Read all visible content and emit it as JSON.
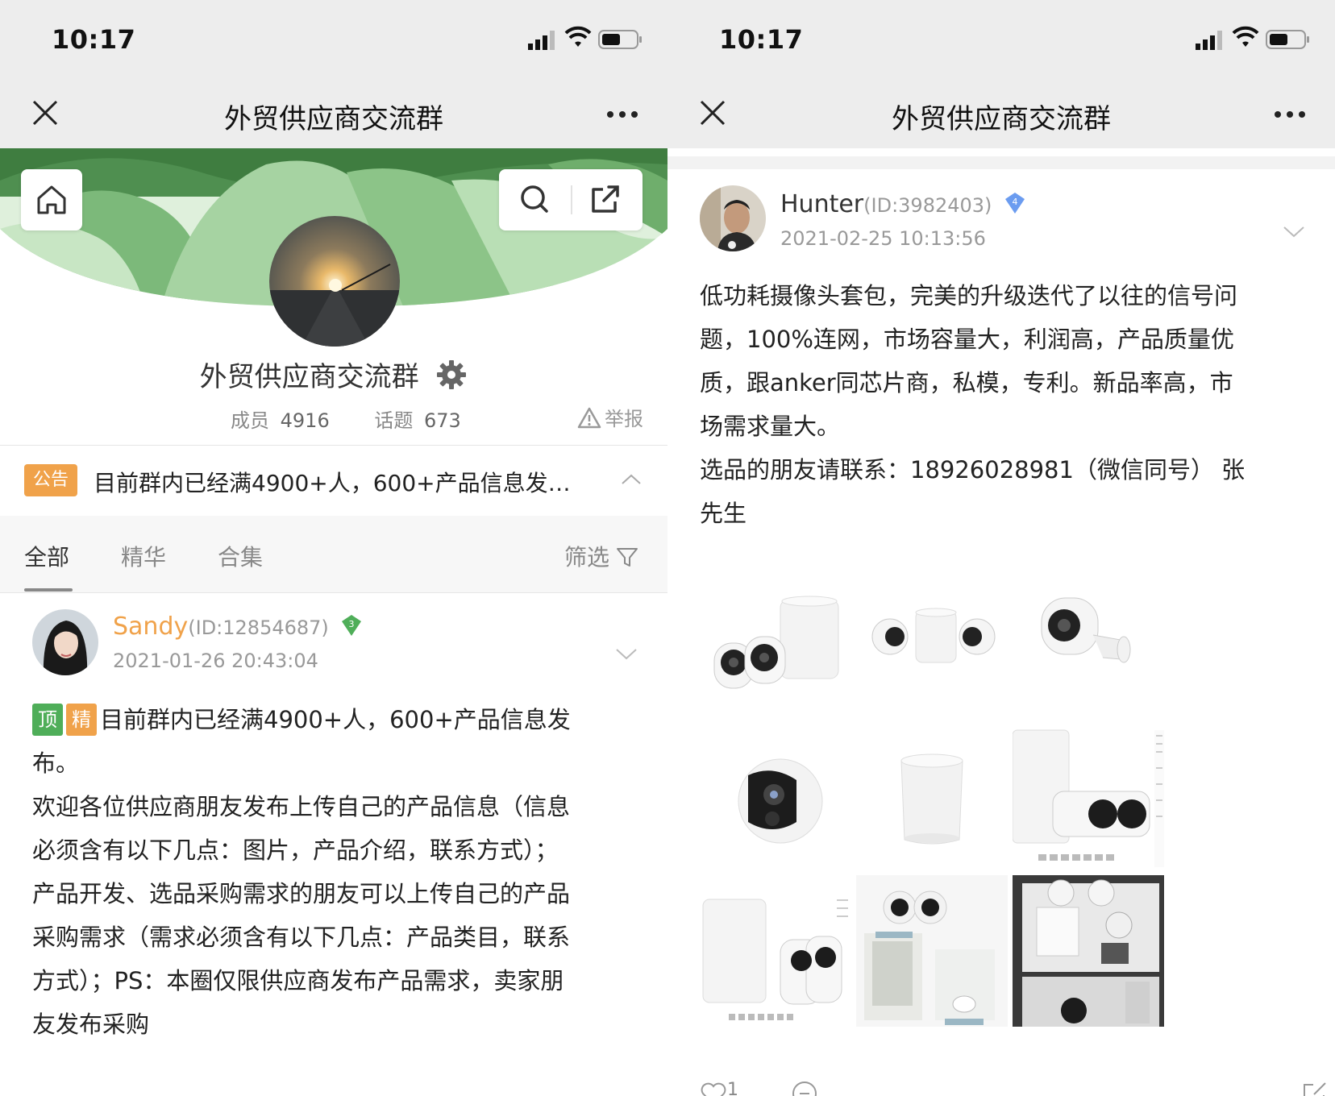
{
  "left": {
    "status": {
      "time": "10:17"
    },
    "nav": {
      "title": "外贸供应商交流群"
    },
    "group": {
      "name": "外贸供应商交流群",
      "members_label": "成员",
      "members_value": "4916",
      "topics_label": "话题",
      "topics_value": "673",
      "report_label": "举报"
    },
    "notice": {
      "tag": "公告",
      "text": "目前群内已经满4900+人，600+产品信息发…"
    },
    "tabs": [
      "全部",
      "精华",
      "合集"
    ],
    "filter_label": "筛选",
    "post": {
      "name": "Sandy",
      "uid": "(ID:12854687)",
      "level": "3",
      "date": "2021-01-26 20:43:04",
      "badge_top": "顶",
      "badge_essence": "精",
      "lines": [
        "目前群内已经满4900+人，600+产品信息发",
        "布。",
        "欢迎各位供应商朋友发布上传自己的产品信息（信息",
        "必须含有以下几点：图片，产品介绍，联系方式）；",
        "产品开发、选品采购需求的朋友可以上传自己的产品",
        "采购需求（需求必须含有以下几点：产品类目，联系",
        "方式）；PS：本圈仅限供应商发布产品需求，卖家朋",
        "友发布采购"
      ]
    }
  },
  "right": {
    "status": {
      "time": "10:17"
    },
    "nav": {
      "title": "外贸供应商交流群"
    },
    "post": {
      "name": "Hunter",
      "uid": "(ID:3982403)",
      "level": "4",
      "date": "2021-02-25 10:13:56",
      "lines": [
        "低功耗摄像头套包，完美的升级迭代了以往的信号问",
        "题，100%连网，市场容量大，利润高，产品质量优",
        "质，跟anker同芯片商，私模，专利。新品率高，市",
        "场需求量大。",
        "选品的朋友请联系：18926028981（微信同号） 张",
        "先生"
      ],
      "like_count": "1"
    }
  },
  "colors": {
    "accent_orange": "#f0a24a",
    "accent_green": "#4fae59",
    "banner_green": "#5f9f5f",
    "level_blue": "#6b9cf0"
  }
}
